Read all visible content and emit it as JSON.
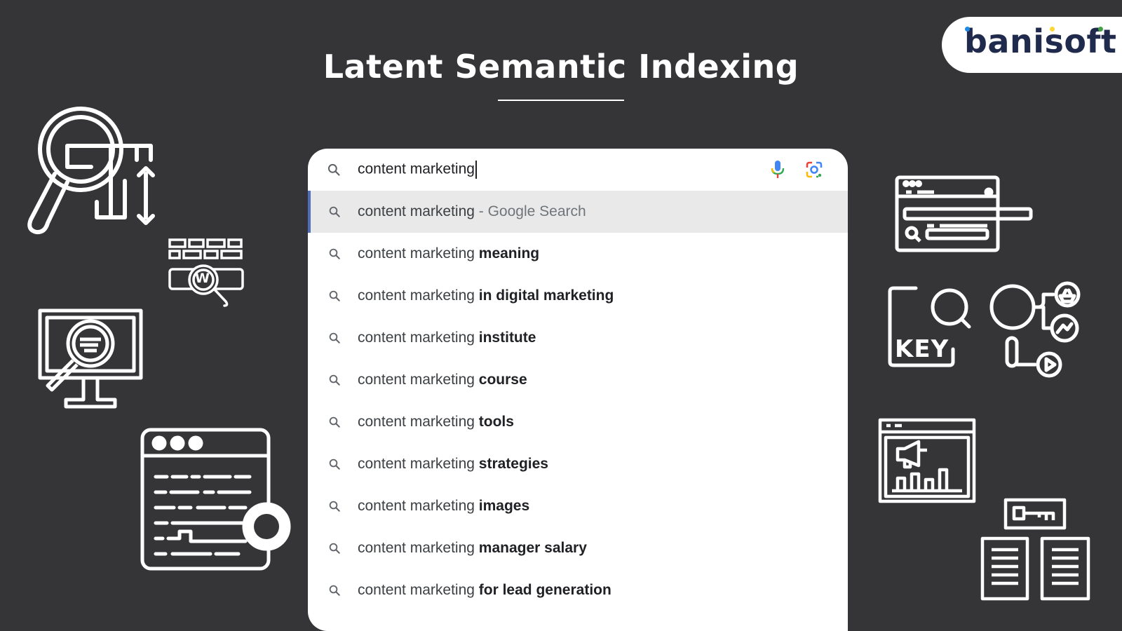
{
  "page": {
    "title": "Latent Semantic Indexing"
  },
  "logo": {
    "text": "banisoft",
    "dot_colors": [
      "#1e88e5",
      "#fdd835",
      "#43a047",
      "#e53935"
    ]
  },
  "search": {
    "query": "content marketing",
    "icons": {
      "search": "search-icon",
      "voice": "microphone-icon",
      "lens": "google-lens-icon"
    },
    "suggestions": [
      {
        "prefix": "content marketing",
        "suffix": " - Google Search",
        "type": "web-search"
      },
      {
        "prefix": "content marketing",
        "suffix": " meaning"
      },
      {
        "prefix": "content marketing",
        "suffix": " in digital marketing"
      },
      {
        "prefix": "content marketing",
        "suffix": " institute"
      },
      {
        "prefix": "content marketing",
        "suffix": " course"
      },
      {
        "prefix": "content marketing",
        "suffix": " tools"
      },
      {
        "prefix": "content marketing",
        "suffix": " strategies"
      },
      {
        "prefix": "content marketing",
        "suffix": " images"
      },
      {
        "prefix": "content marketing",
        "suffix": " manager salary"
      },
      {
        "prefix": "content marketing",
        "suffix": " for lead generation"
      }
    ]
  },
  "decorations": {
    "keyword_icon_label": "KEY",
    "web_icon_label": "W",
    "icons": [
      "seo-magnifier-icon",
      "web-keyword-search-icon",
      "monitor-search-icon",
      "browser-code-search-icon",
      "browser-search-bar-icon",
      "keyword-search-icon",
      "search-media-network-icon",
      "marketing-analytics-icon",
      "key-documents-icon"
    ]
  },
  "colors": {
    "background": "#353538",
    "panel": "#ffffff",
    "active_row": "#e9e9e9",
    "active_marker": "#4f6fb8",
    "text": "#202124",
    "muted": "#70757a"
  }
}
